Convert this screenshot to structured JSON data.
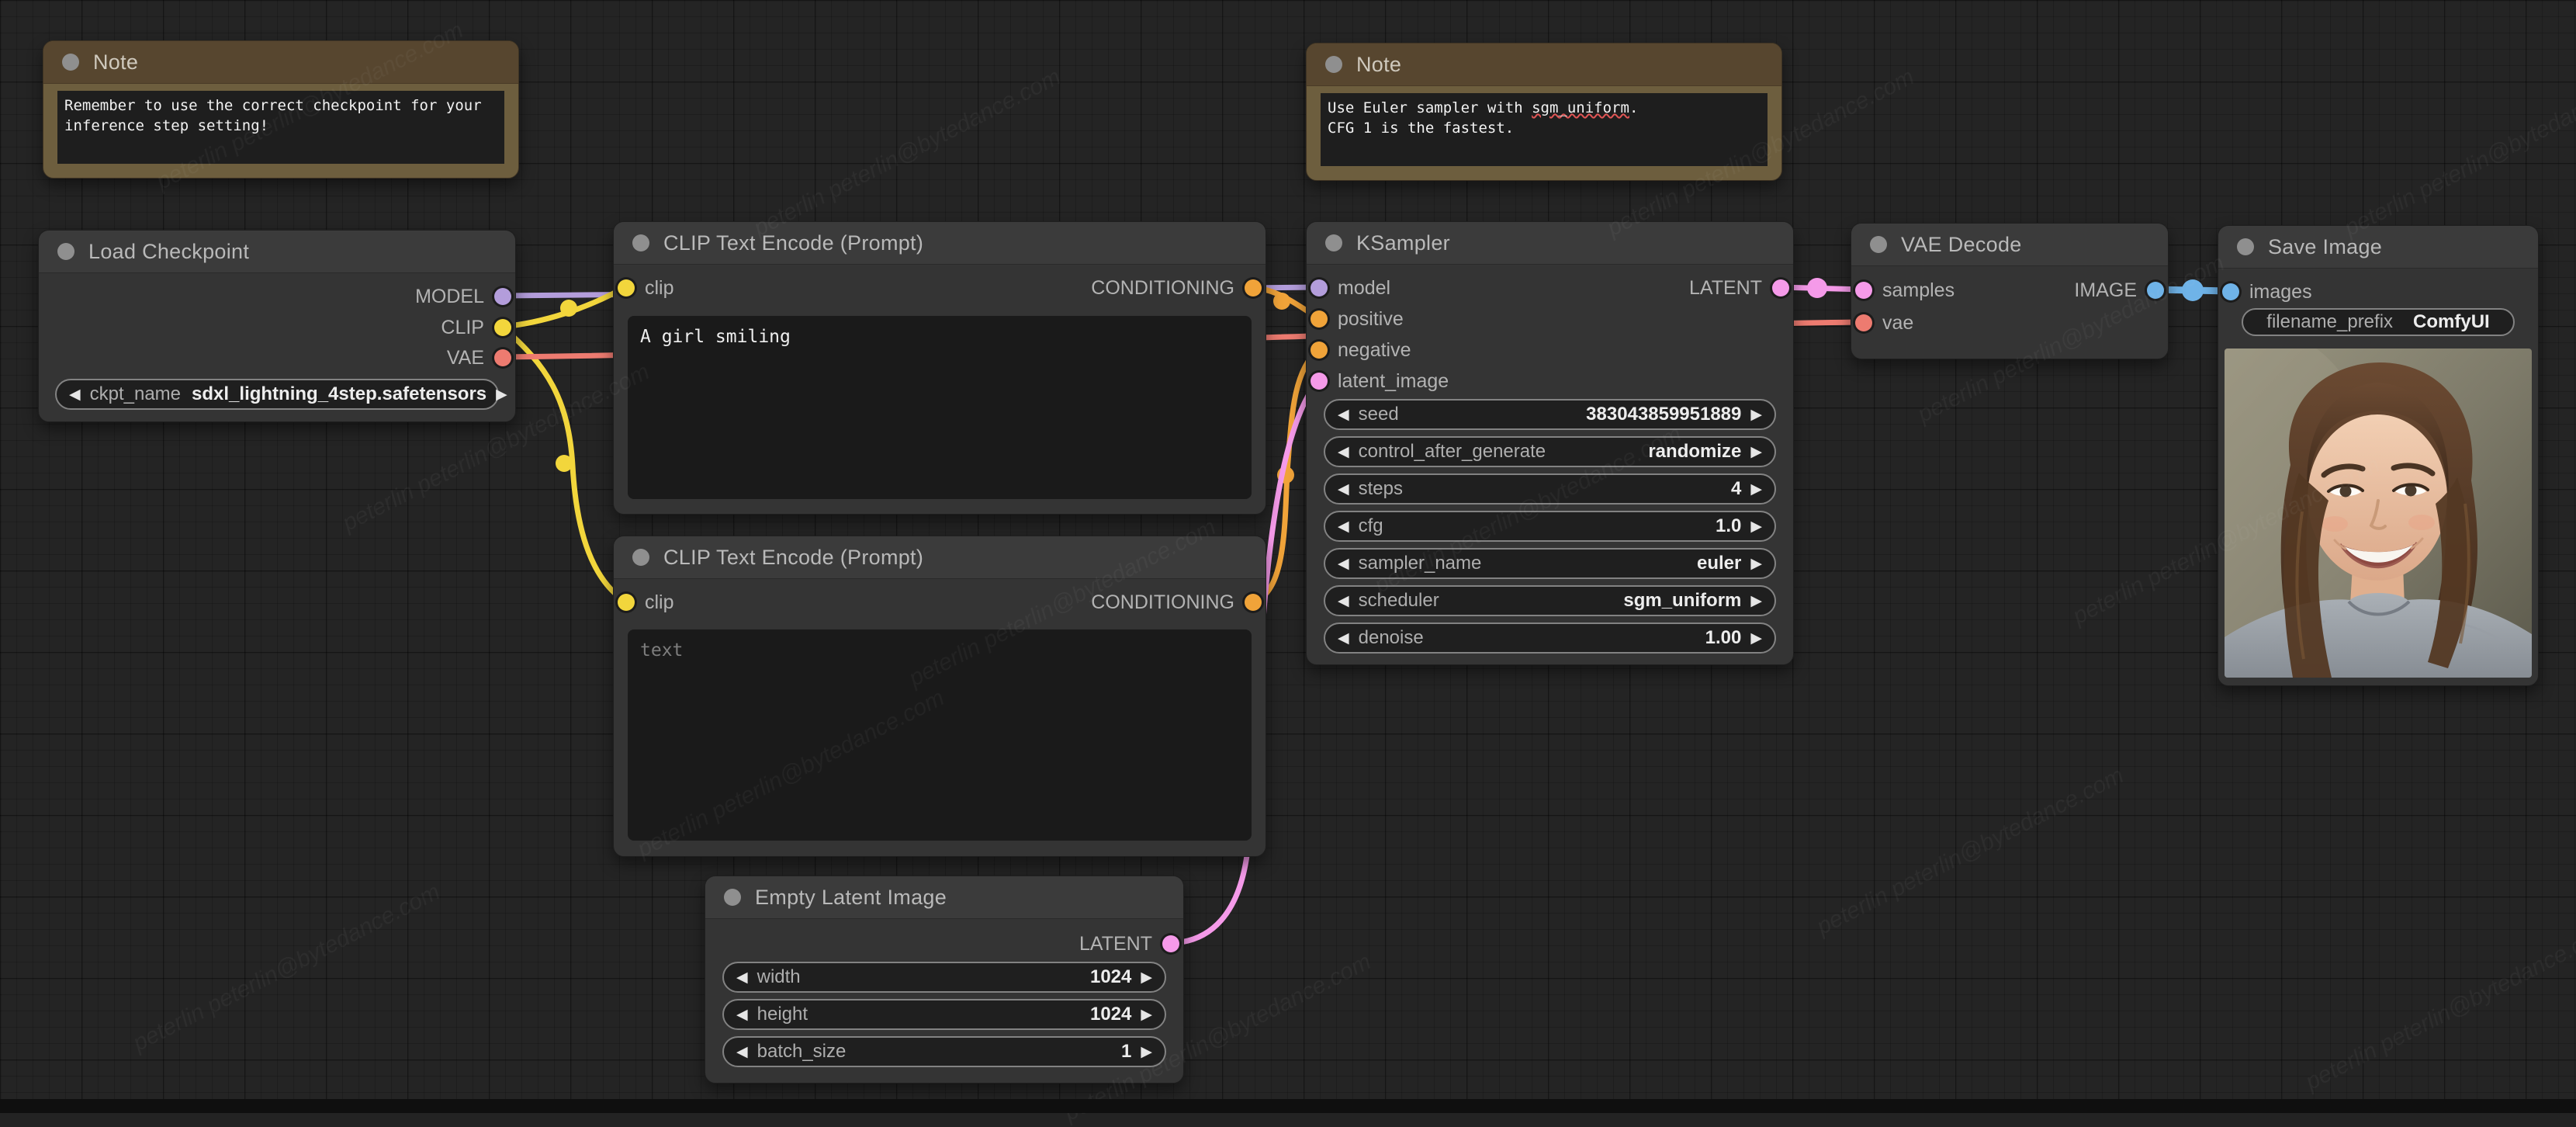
{
  "canvas": {
    "background": "#242424"
  },
  "icons": {
    "left_arrow": "◀",
    "right_arrow": "▶"
  },
  "watermark": {
    "text": "peterlin peterlin@bytedance.com"
  },
  "colors": {
    "model": "#b39ddb",
    "clip": "#f2d63c",
    "vae": "#ed7b70",
    "conditioning": "#f0a339",
    "latent": "#f59ae9",
    "image": "#6fb3e8"
  },
  "notes": {
    "first": {
      "title": "Note",
      "text": "Remember to use the correct checkpoint for your\ninference step setting!"
    },
    "second": {
      "title": "Note",
      "line1_pre": "Use Euler sampler with ",
      "line1_word": "sgm_uniform",
      "line1_post": ".",
      "line2": "CFG 1 is the fastest."
    }
  },
  "load_checkpoint": {
    "title": "Load Checkpoint",
    "outputs": [
      {
        "label": "MODEL"
      },
      {
        "label": "CLIP"
      },
      {
        "label": "VAE"
      }
    ],
    "widgets": [
      {
        "name": "ckpt_name",
        "value": "sdxl_lightning_4step.safetensors"
      }
    ]
  },
  "clip_encode_positive": {
    "title": "CLIP Text Encode (Prompt)",
    "input": "clip",
    "output": "CONDITIONING",
    "text": "A girl smiling"
  },
  "clip_encode_negative": {
    "title": "CLIP Text Encode (Prompt)",
    "input": "clip",
    "output": "CONDITIONING",
    "placeholder": "text"
  },
  "ksampler": {
    "title": "KSampler",
    "inputs": [
      {
        "label": "model"
      },
      {
        "label": "positive"
      },
      {
        "label": "negative"
      },
      {
        "label": "latent_image"
      }
    ],
    "output": "LATENT",
    "widgets": [
      {
        "name": "seed",
        "value": "383043859951889"
      },
      {
        "name": "control_after_generate",
        "value": "randomize"
      },
      {
        "name": "steps",
        "value": "4"
      },
      {
        "name": "cfg",
        "value": "1.0"
      },
      {
        "name": "sampler_name",
        "value": "euler"
      },
      {
        "name": "scheduler",
        "value": "sgm_uniform"
      },
      {
        "name": "denoise",
        "value": "1.00"
      }
    ]
  },
  "vae_decode": {
    "title": "VAE Decode",
    "inputs": [
      {
        "label": "samples"
      },
      {
        "label": "vae"
      }
    ],
    "output": "IMAGE"
  },
  "save_image": {
    "title": "Save Image",
    "input": "images",
    "widgets": [
      {
        "name": "filename_prefix",
        "value": "ComfyUI"
      }
    ],
    "preview_alt": "Generated photo: smiling young woman with long brown wavy hair, gray sweater"
  },
  "empty_latent": {
    "title": "Empty Latent Image",
    "output": "LATENT",
    "widgets": [
      {
        "name": "width",
        "value": "1024"
      },
      {
        "name": "height",
        "value": "1024"
      },
      {
        "name": "batch_size",
        "value": "1"
      }
    ]
  }
}
